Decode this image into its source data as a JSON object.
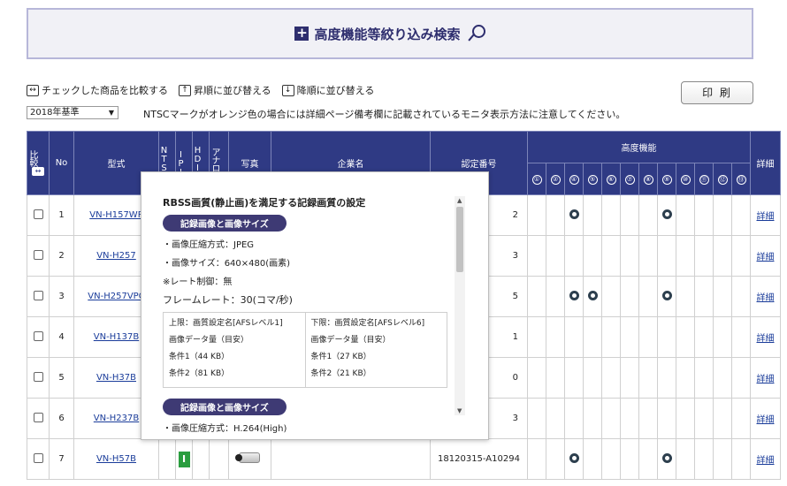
{
  "banner": {
    "title": "高度機能等絞り込み検索",
    "plus": "+"
  },
  "toolbar": {
    "compare": "チェックした商品を比較する",
    "asc": "昇順に並び替える",
    "desc": "降順に並び替える",
    "print": "印 刷"
  },
  "filter": {
    "year": "2018年基準",
    "notice": "NTSCマークがオレンジ色の場合には詳細ページ備考欄に記載されているモニタ表示方法に注意してください。"
  },
  "table": {
    "headers": {
      "compare": "比較",
      "no": "No",
      "model": "型式",
      "ntsc": "NTSC",
      "ipi": "IPI",
      "hdi": "HDIS",
      "analog": "アナログ",
      "photo": "写真",
      "company": "企業名",
      "cert": "認定番号",
      "advanced": "高度機能",
      "detail": "詳細",
      "features": [
        "①",
        "②",
        "④",
        "⑤",
        "⑥",
        "⑦",
        "⑧",
        "⑨",
        "⑩",
        "⑪",
        "⑫",
        "⑬"
      ]
    },
    "rows": [
      {
        "no": "1",
        "model": "VN-H157WP",
        "cert": "2",
        "features": [
          false,
          false,
          true,
          false,
          false,
          false,
          false,
          true,
          false,
          false,
          false,
          false
        ],
        "detail": "詳細"
      },
      {
        "no": "2",
        "model": "VN-H257",
        "cert": "3",
        "features": [
          false,
          false,
          false,
          false,
          false,
          false,
          false,
          false,
          false,
          false,
          false,
          false
        ],
        "detail": "詳細"
      },
      {
        "no": "3",
        "model": "VN-H257VPC",
        "cert": "5",
        "features": [
          false,
          false,
          true,
          true,
          false,
          false,
          false,
          true,
          false,
          false,
          false,
          false
        ],
        "detail": "詳細"
      },
      {
        "no": "4",
        "model": "VN-H137B",
        "cert": "1",
        "features": [
          false,
          false,
          false,
          false,
          false,
          false,
          false,
          false,
          false,
          false,
          false,
          false
        ],
        "detail": "詳細"
      },
      {
        "no": "5",
        "model": "VN-H37B",
        "cert": "0",
        "features": [
          false,
          false,
          false,
          false,
          false,
          false,
          false,
          false,
          false,
          false,
          false,
          false
        ],
        "detail": "詳細"
      },
      {
        "no": "6",
        "model": "VN-H237B",
        "cert": "3",
        "features": [
          false,
          false,
          false,
          false,
          false,
          false,
          false,
          false,
          false,
          false,
          false,
          false
        ],
        "detail": "詳細"
      },
      {
        "no": "7",
        "model": "VN-H57B",
        "cert": "18120315-A10294",
        "ipi": "I",
        "features": [
          false,
          false,
          true,
          false,
          false,
          false,
          false,
          true,
          false,
          false,
          false,
          false
        ],
        "detail": "詳細"
      }
    ]
  },
  "popup": {
    "title": "RBSS画質(静止画)を満足する記録画質の設定",
    "section1": "記録画像と画像サイズ",
    "compression": "・画像圧縮方式：JPEG",
    "size": "・画像サイズ：640×480(画素)",
    "rate_limit": "※レート制御：無",
    "framerate": "フレームレート：30(コマ/秒)",
    "upper": {
      "label": "上限：画質設定名[AFSレベル1]",
      "amount": "画像データ量（目安）",
      "c1": "条件1（44 KB）",
      "c2": "条件2（81 KB）"
    },
    "lower": {
      "label": "下限：画質設定名[AFSレベル6]",
      "amount": "画像データ量（目安）",
      "c1": "条件1（27 KB）",
      "c2": "条件2（21 KB）"
    },
    "section2": "記録画像と画像サイズ",
    "compression2": "・画像圧縮方式：H.264(High)"
  }
}
